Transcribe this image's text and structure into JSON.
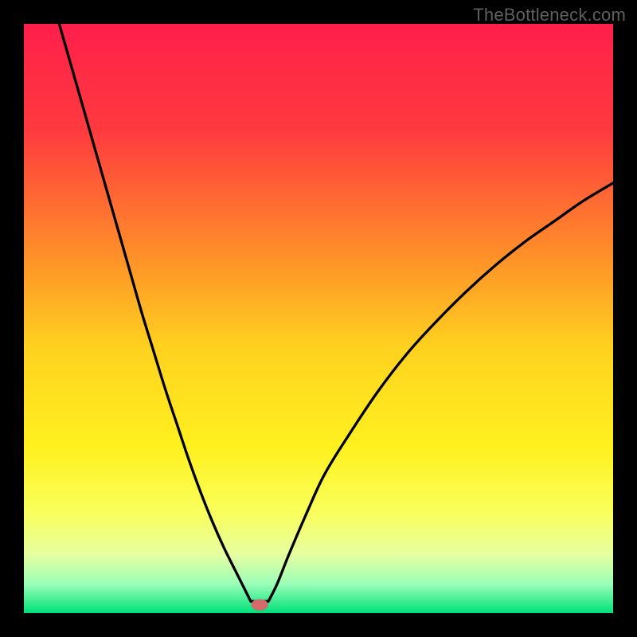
{
  "watermark": "TheBottleneck.com",
  "chart_data": {
    "type": "line",
    "title": "",
    "xlabel": "",
    "ylabel": "",
    "xlim": [
      0,
      100
    ],
    "ylim": [
      0,
      100
    ],
    "grid": false,
    "legend": false,
    "gradient_stops": [
      {
        "pos": 0.0,
        "color": "#ff1f4b"
      },
      {
        "pos": 0.18,
        "color": "#ff3a3f"
      },
      {
        "pos": 0.38,
        "color": "#ff8a2a"
      },
      {
        "pos": 0.55,
        "color": "#ffd21f"
      },
      {
        "pos": 0.72,
        "color": "#fff11f"
      },
      {
        "pos": 0.83,
        "color": "#f9ff5c"
      },
      {
        "pos": 0.9,
        "color": "#e6ffa0"
      },
      {
        "pos": 0.95,
        "color": "#9cffb8"
      },
      {
        "pos": 1.0,
        "color": "#00e07a"
      }
    ],
    "curve_left": {
      "x": [
        6,
        8,
        10,
        12,
        14,
        16,
        18,
        20,
        22,
        24,
        26,
        28,
        30,
        32,
        34,
        36,
        37.5,
        38.5
      ],
      "y": [
        100,
        93,
        86,
        79,
        72,
        65,
        58,
        51,
        44.5,
        38,
        32,
        26,
        20.5,
        15.5,
        11,
        7,
        4,
        2
      ]
    },
    "curve_right": {
      "x": [
        41.5,
        43,
        45,
        48,
        51,
        55,
        60,
        65,
        70,
        75,
        80,
        85,
        90,
        95,
        100
      ],
      "y": [
        2,
        5,
        10,
        17,
        23.5,
        30,
        37.5,
        44,
        49.5,
        54.5,
        59,
        63,
        66.5,
        70,
        73
      ]
    },
    "flat_segment": {
      "x0": 38.5,
      "x1": 41.5,
      "y": 2
    },
    "marker": {
      "x": 40,
      "y": 1.4,
      "w_pct": 2.8,
      "h_pct": 2.0,
      "color": "#d46a6a"
    }
  }
}
